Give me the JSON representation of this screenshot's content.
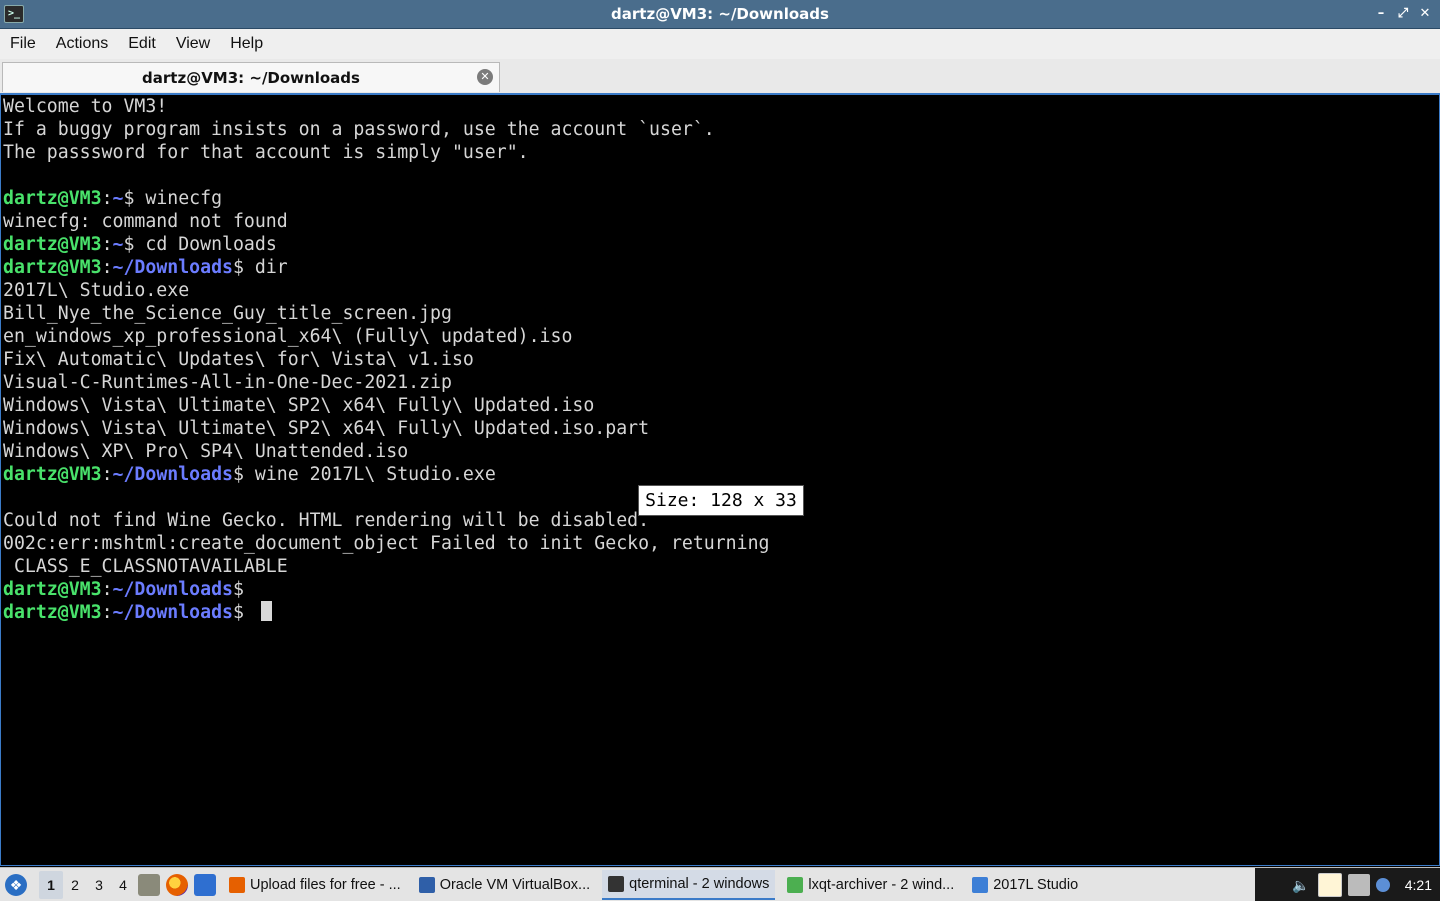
{
  "window": {
    "title": "dartz@VM3: ~/Downloads",
    "controls": {
      "minimize": "–",
      "maximize": "⤢",
      "close": "✕"
    }
  },
  "menu": {
    "items": [
      "File",
      "Actions",
      "Edit",
      "View",
      "Help"
    ]
  },
  "tab": {
    "label": "dartz@VM3: ~/Downloads",
    "close": "✕"
  },
  "terminal": {
    "lines": [
      {
        "text": "Welcome to VM3!"
      },
      {
        "text": "If a buggy program insists on a password, use the account `user`."
      },
      {
        "text": "The passsword for that account is simply \"user\"."
      },
      {
        "text": ""
      },
      {
        "user": "dartz@VM3",
        "sep": ":",
        "path": "~",
        "prompt": "$",
        "cmd": " winecfg"
      },
      {
        "text": "winecfg: command not found"
      },
      {
        "user": "dartz@VM3",
        "sep": ":",
        "path": "~",
        "prompt": "$",
        "cmd": " cd Downloads"
      },
      {
        "user": "dartz@VM3",
        "sep": ":",
        "path": "~/Downloads",
        "prompt": "$",
        "cmd": " dir"
      },
      {
        "text": "2017L\\ Studio.exe"
      },
      {
        "text": "Bill_Nye_the_Science_Guy_title_screen.jpg"
      },
      {
        "text": "en_windows_xp_professional_x64\\ (Fully\\ updated).iso"
      },
      {
        "text": "Fix\\ Automatic\\ Updates\\ for\\ Vista\\ v1.iso"
      },
      {
        "text": "Visual-C-Runtimes-All-in-One-Dec-2021.zip"
      },
      {
        "text": "Windows\\ Vista\\ Ultimate\\ SP2\\ x64\\ Fully\\ Updated.iso"
      },
      {
        "text": "Windows\\ Vista\\ Ultimate\\ SP2\\ x64\\ Fully\\ Updated.iso.part"
      },
      {
        "text": "Windows\\ XP\\ Pro\\ SP4\\ Unattended.iso"
      },
      {
        "user": "dartz@VM3",
        "sep": ":",
        "path": "~/Downloads",
        "prompt": "$",
        "cmd": " wine 2017L\\ Studio.exe"
      },
      {
        "text": ""
      },
      {
        "text": "Could not find Wine Gecko. HTML rendering will be disabled."
      },
      {
        "text": "002c:err:mshtml:create_document_object Failed to init Gecko, returning"
      },
      {
        "text": " CLASS_E_CLASSNOTAVAILABLE"
      },
      {
        "user": "dartz@VM3",
        "sep": ":",
        "path": "~/Downloads",
        "prompt": "$",
        "cmd": ""
      },
      {
        "user": "dartz@VM3",
        "sep": ":",
        "path": "~/Downloads",
        "prompt": "$",
        "cmd": " ",
        "cursor": true
      }
    ],
    "tooltip": "Size: 128 x 33"
  },
  "taskbar": {
    "workspaces": [
      "1",
      "2",
      "3",
      "4"
    ],
    "active_workspace": "1",
    "tasks": [
      {
        "label": "Upload files for free - ...",
        "icon": "firefox-icon",
        "color": "#e66000"
      },
      {
        "label": "Oracle VM VirtualBox...",
        "icon": "virtualbox-icon",
        "color": "#2f5fa8"
      },
      {
        "label": "qterminal - 2 windows",
        "icon": "terminal-icon",
        "color": "#333333",
        "active": true
      },
      {
        "label": "lxqt-archiver - 2 wind...",
        "icon": "archive-icon",
        "color": "#4caf50"
      },
      {
        "label": "2017L Studio",
        "icon": "folder-icon",
        "color": "#3d7fd6"
      }
    ],
    "clock": "4:21"
  }
}
